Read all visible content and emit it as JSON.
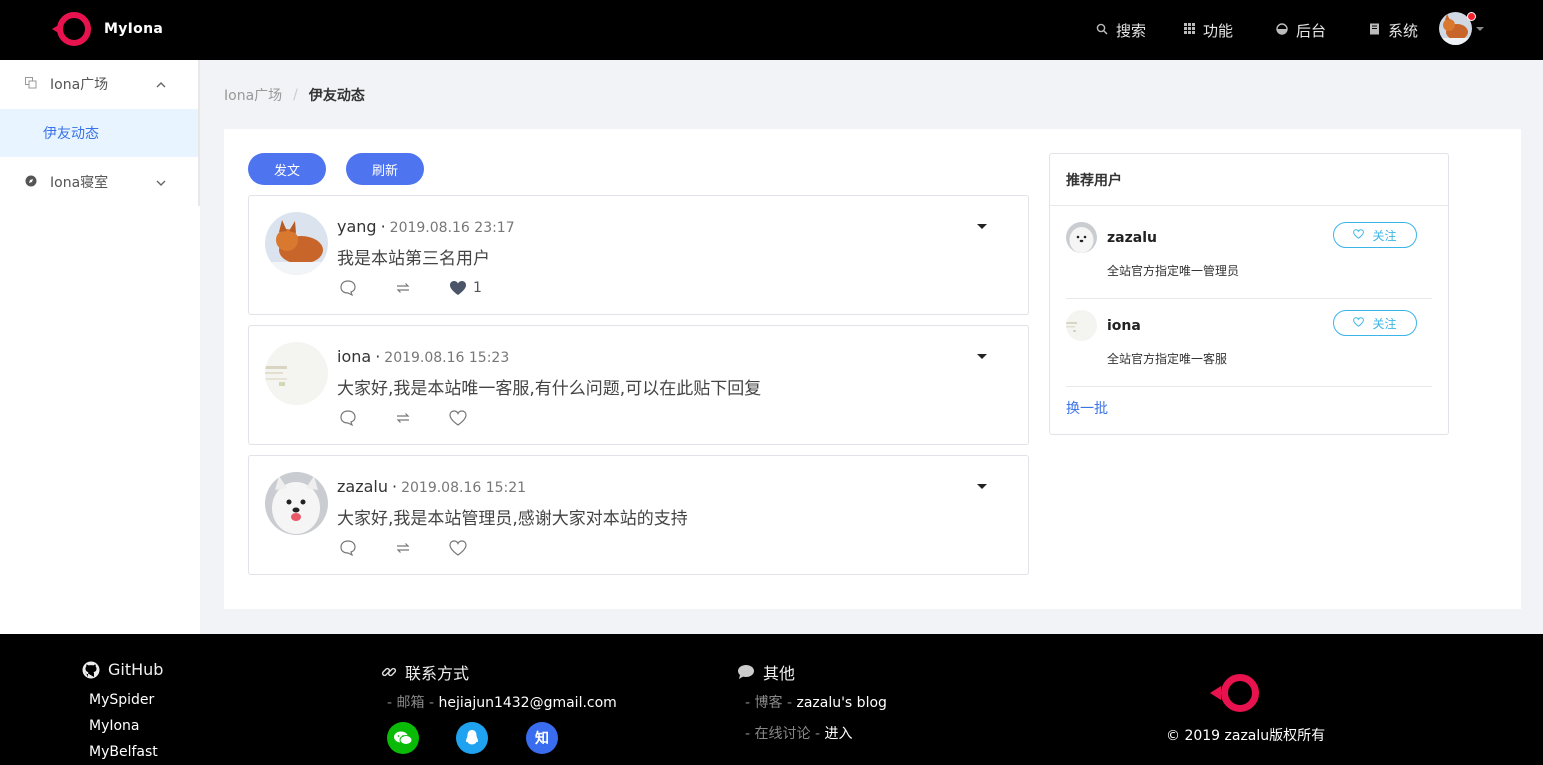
{
  "header": {
    "brand": "MyIona",
    "nav": [
      {
        "icon": "search-icon",
        "label": "搜索"
      },
      {
        "icon": "grid-icon",
        "label": "功能"
      },
      {
        "icon": "dashboard-icon",
        "label": "后台"
      },
      {
        "icon": "book-icon",
        "label": "系统"
      }
    ]
  },
  "sidebar": {
    "groups": [
      {
        "icon": "copy-icon",
        "label": "Iona广场",
        "expanded": true,
        "children": [
          {
            "label": "伊友动态",
            "active": true
          }
        ]
      },
      {
        "icon": "compass-icon",
        "label": "Iona寝室",
        "expanded": false
      }
    ]
  },
  "breadcrumb": [
    "Iona广场",
    "伊友动态"
  ],
  "toolbar": {
    "post_label": "发文",
    "refresh_label": "刷新"
  },
  "posts": [
    {
      "user": "yang",
      "time": "2019.08.16 23:17",
      "text": "我是本站第三名用户",
      "likes": "1",
      "liked": true
    },
    {
      "user": "iona",
      "time": "2019.08.16 15:23",
      "text": "大家好,我是本站唯一客服,有什么问题,可以在此贴下回复",
      "likes": "",
      "liked": false
    },
    {
      "user": "zazalu",
      "time": "2019.08.16 15:21",
      "text": "大家好,我是本站管理员,感谢大家对本站的支持",
      "likes": "",
      "liked": false
    }
  ],
  "recommend": {
    "title": "推荐用户",
    "users": [
      {
        "name": "zazalu",
        "desc": "全站官方指定唯一管理员",
        "follow_label": "关注"
      },
      {
        "name": "iona",
        "desc": "全站官方指定唯一客服",
        "follow_label": "关注"
      }
    ],
    "more_label": "换一批"
  },
  "footer": {
    "github": {
      "title": "GitHub",
      "links": [
        "MySpider",
        "MyIona",
        "MyBelfast"
      ]
    },
    "contact": {
      "title": "联系方式",
      "email_prefix": "- 邮箱 -",
      "email": "hejiajun1432@gmail.com",
      "social": [
        "微",
        "Q",
        "知"
      ]
    },
    "other": {
      "title": "其他",
      "blog_prefix": "- 博客 -",
      "blog": "zazalu's blog",
      "discuss_prefix": "- 在线讨论 -",
      "discuss": "进入"
    },
    "copyright": "© 2019 zazalu版权所有"
  },
  "colors": {
    "accent": "#4f74ef",
    "brand_red": "#e8134e",
    "follow": "#3bb5e8"
  }
}
